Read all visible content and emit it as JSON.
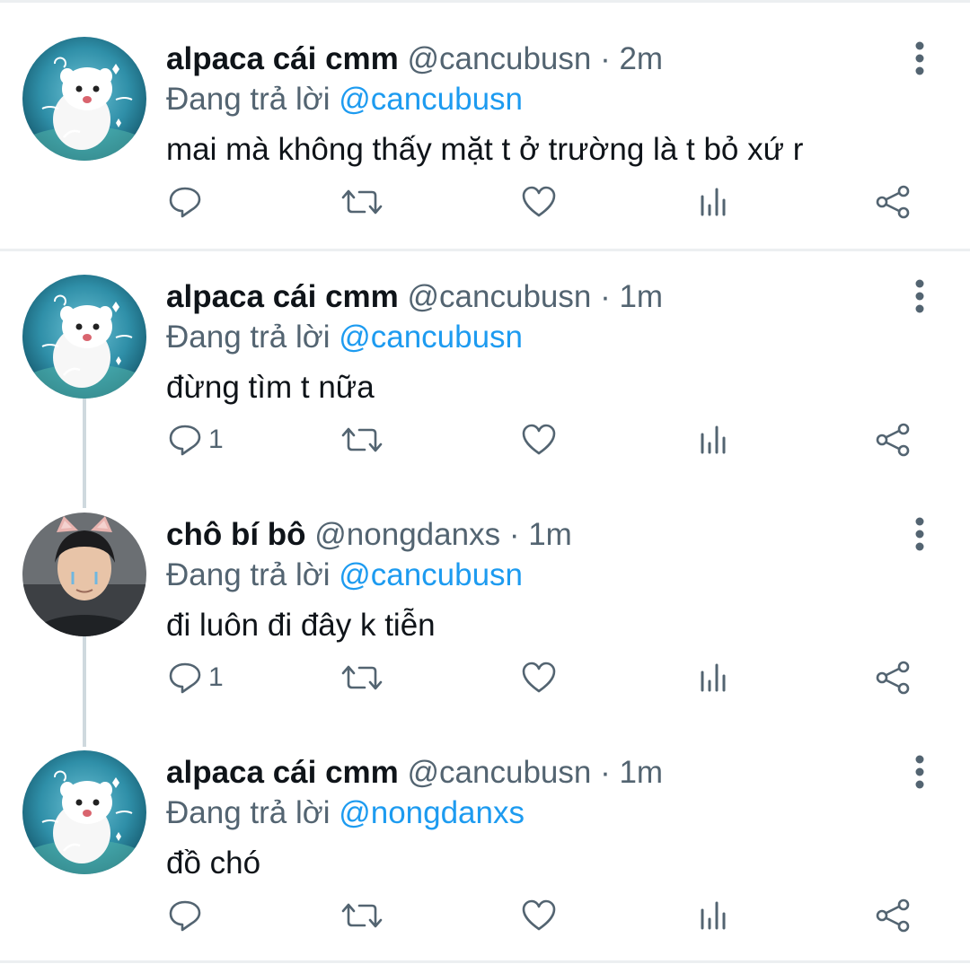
{
  "tweets": [
    {
      "author": "alpaca cái cmm",
      "handle": "@cancubusn",
      "separator": "·",
      "time": "2m",
      "replying_prefix": "Đang trả lời",
      "replying_to": "@cancubusn",
      "text": "mai mà không thấy mặt t ở trường là t bỏ xứ r",
      "reply_count": "",
      "avatar": "ferret-avatar"
    },
    {
      "author": "alpaca cái cmm",
      "handle": "@cancubusn",
      "separator": "·",
      "time": "1m",
      "replying_prefix": "Đang trả lời",
      "replying_to": "@cancubusn",
      "text": "đừng tìm t nữa",
      "reply_count": "1",
      "avatar": "ferret-avatar"
    },
    {
      "author": "chô bí bô",
      "handle": "@nongdanxs",
      "separator": "·",
      "time": "1m",
      "replying_prefix": "Đang trả lời",
      "replying_to": "@cancubusn",
      "text": "đi luôn đi đây k tiễn",
      "reply_count": "1",
      "avatar": "person-avatar"
    },
    {
      "author": "alpaca cái cmm",
      "handle": "@cancubusn",
      "separator": "·",
      "time": "1m",
      "replying_prefix": "Đang trả lời",
      "replying_to": "@nongdanxs",
      "text": "đồ chó",
      "reply_count": "",
      "avatar": "ferret-avatar"
    }
  ],
  "colors": {
    "text": "#0f1419",
    "secondary": "#536471",
    "accent": "#1d9bf0",
    "divider": "#eceff1"
  },
  "icons": [
    "reply-icon",
    "retweet-icon",
    "like-icon",
    "views-icon",
    "share-icon",
    "more-icon"
  ]
}
